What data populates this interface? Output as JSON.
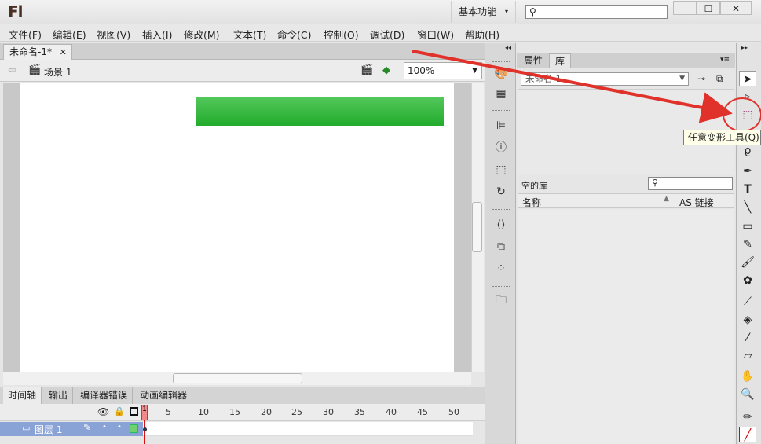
{
  "app": {
    "logo": "Fl",
    "workspace": "基本功能"
  },
  "window": {
    "min": "—",
    "max": "☐",
    "close": "✕"
  },
  "menu": [
    "文件(F)",
    "编辑(E)",
    "视图(V)",
    "插入(I)",
    "修改(M)",
    "文本(T)",
    "命令(C)",
    "控制(O)",
    "调试(D)",
    "窗口(W)",
    "帮助(H)"
  ],
  "document": {
    "tab": "未命名-1*",
    "scene": "场景 1",
    "zoom": "100%"
  },
  "timeline": {
    "tabs": [
      "时间轴",
      "输出",
      "编译器错误",
      "动画编辑器"
    ],
    "frames": [
      "1",
      "5",
      "10",
      "15",
      "20",
      "25",
      "30",
      "35",
      "40",
      "45",
      "50"
    ],
    "layer": "图层 1"
  },
  "library": {
    "tabs": [
      "属性",
      "库"
    ],
    "selected_doc": "未命名-1",
    "status": "空的库",
    "col_name": "名称",
    "col_link": "AS 链接"
  },
  "tooltip": "任意变形工具(Q)",
  "colors": {
    "stage_shape": "#2fb437",
    "annotation": "#e0322a",
    "layer_selected": "#8aa3d6"
  }
}
